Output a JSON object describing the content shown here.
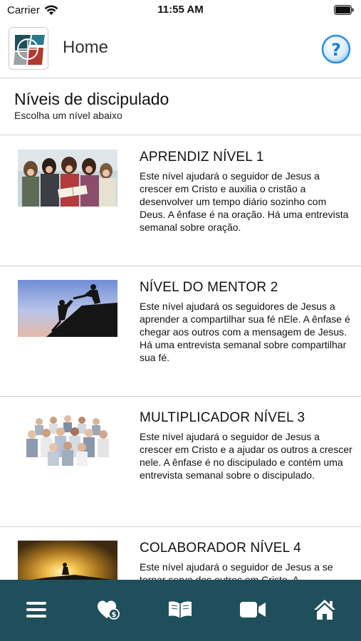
{
  "status_bar": {
    "carrier": "Carrier",
    "time": "11:55 AM"
  },
  "header": {
    "title": "Home"
  },
  "section": {
    "title": "Níveis de discipulado",
    "subtitle": "Escolha um nível abaixo"
  },
  "levels": [
    {
      "title": "APRENDIZ NÍVEL 1",
      "description": "Este nível ajudará o seguidor de Jesus a crescer em Cristo e auxilia o cristão a desenvolver um tempo diário sozinho com Deus. A ênfase é na oração. Há uma entrevista semanal sobre oração.",
      "image": "women-reading-bible"
    },
    {
      "title": "NÍVEL DO MENTOR 2",
      "description": "Este nível ajudará os seguidores de Jesus a aprender a compartilhar sua fé nEle. A ênfase é chegar aos outros com a mensagem de Jesus. Há uma entrevista semanal sobre compartilhar sua fé.",
      "image": "helping-hand-climb"
    },
    {
      "title": "MULTIPLICADOR NÍVEL 3",
      "description": "Este nível ajudará o seguidor de Jesus a crescer em Cristo e a ajudar os outros a crescer nele. A ênfase é no discipulado e contém uma entrevista semanal sobre o discipulado.",
      "image": "group-of-people"
    },
    {
      "title": "COLABORADOR NÍVEL 4",
      "description": "Este nível ajudará o seguidor de Jesus a se tornar servo dos outros em Cristo. A",
      "image": "sunset-climb"
    }
  ],
  "tab_bar": {
    "background": "#1f4f5b",
    "items": [
      "menu-icon",
      "heart-donate-icon",
      "bible-icon",
      "video-icon",
      "home-icon"
    ]
  }
}
